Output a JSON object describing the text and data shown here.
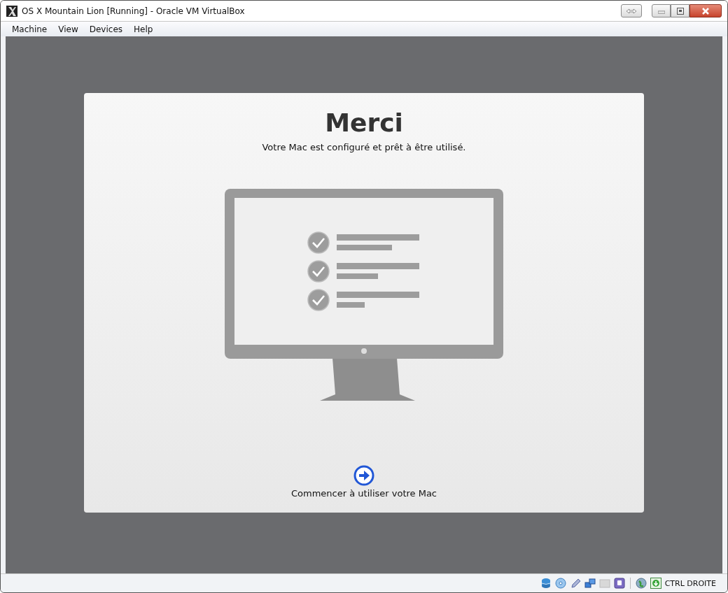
{
  "window": {
    "title": "OS X Mountain Lion [Running] - Oracle VM VirtualBox"
  },
  "menu": [
    "Machine",
    "View",
    "Devices",
    "Help"
  ],
  "setup": {
    "heading": "Merci",
    "subtitle": "Votre Mac est configuré et prêt à être utilisé.",
    "continue_label": "Commencer à utiliser votre Mac"
  },
  "status_bar": {
    "host_key": "CTRL DROITE"
  }
}
